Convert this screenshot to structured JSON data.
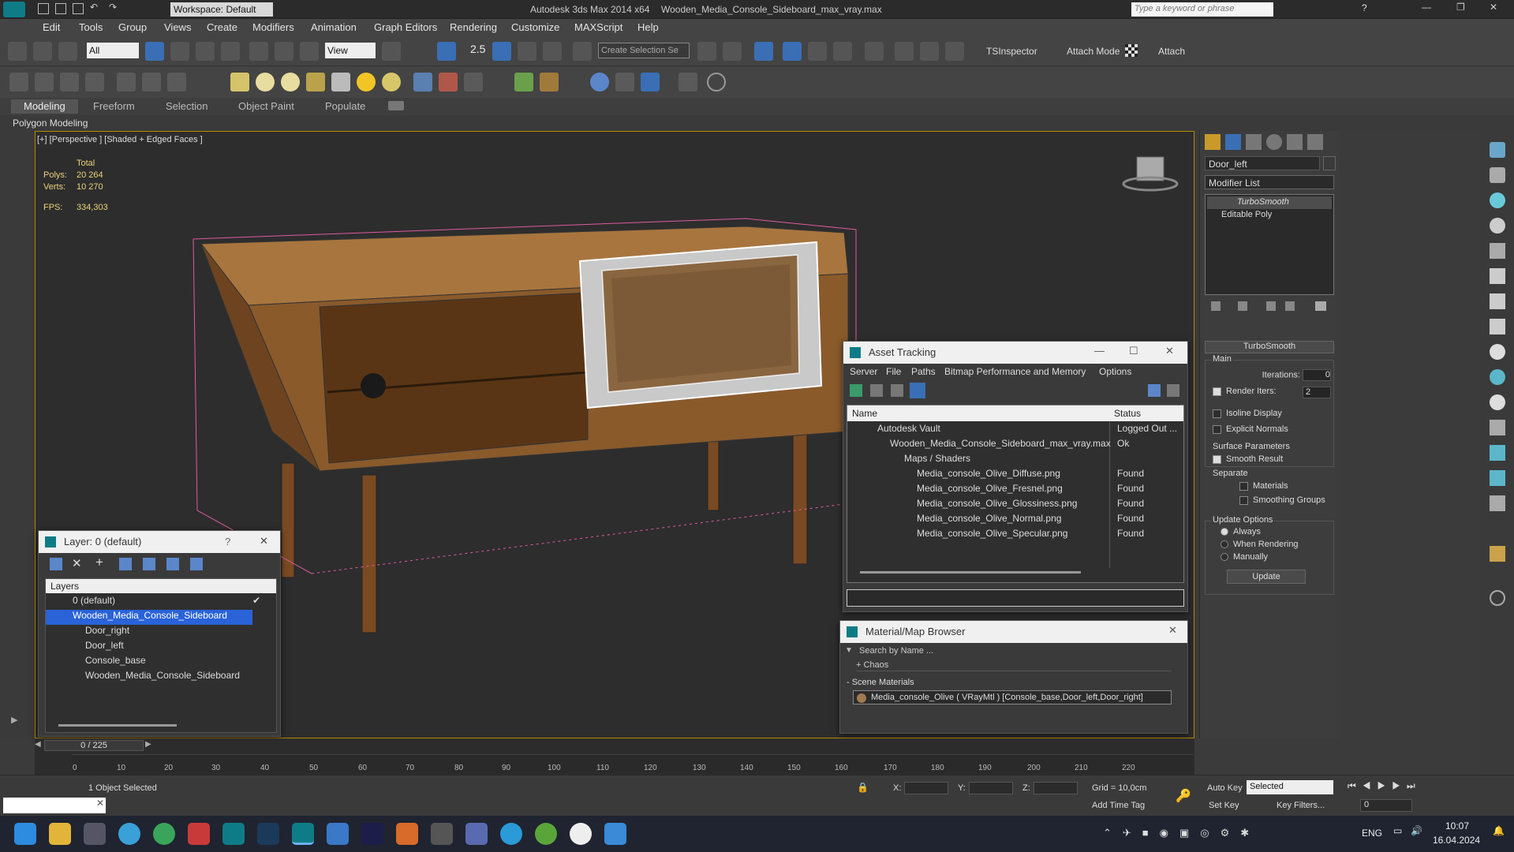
{
  "titlebar": {
    "workspace": "Workspace: Default",
    "app_title": "Autodesk 3ds Max  2014 x64",
    "file_title": "Wooden_Media_Console_Sideboard_max_vray.max",
    "search_placeholder": "Type a keyword or phrase"
  },
  "menu": [
    "Edit",
    "Tools",
    "Group",
    "Views",
    "Create",
    "Modifiers",
    "Animation",
    "Graph Editors",
    "Rendering",
    "Customize",
    "MAXScript",
    "Help"
  ],
  "toolbar": {
    "selection_filter": "All",
    "ref_coord": "View",
    "selection_set_placeholder": "Create Selection Se",
    "tsinspector": "TSInspector",
    "attach_mode": "Attach Mode",
    "attach": "Attach",
    "snap_value": "2.5"
  },
  "ribbon": {
    "tabs": [
      "Modeling",
      "Freeform",
      "Selection",
      "Object Paint",
      "Populate"
    ],
    "subtitle": "Polygon Modeling"
  },
  "viewport": {
    "label": "[+] [Perspective ] [Shaded + Edged Faces ]",
    "stats_header": "Total",
    "polys_label": "Polys:",
    "polys_value": "20 264",
    "verts_label": "Verts:",
    "verts_value": "10 270",
    "fps_label": "FPS:",
    "fps_value": "334,303"
  },
  "layer_window": {
    "title": "Layer: 0 (default)",
    "help": "?",
    "column": "Layers",
    "rows": [
      "0 (default)",
      "Wooden_Media_Console_Sideboard",
      "Door_right",
      "Door_left",
      "Console_base",
      "Wooden_Media_Console_Sideboard"
    ]
  },
  "asset_tracking": {
    "title": "Asset Tracking",
    "menu": [
      "Server",
      "File",
      "Paths",
      "Bitmap Performance and Memory",
      "Options"
    ],
    "col_name": "Name",
    "col_status": "Status",
    "rows": [
      {
        "name": "Autodesk Vault",
        "status": "Logged Out ..."
      },
      {
        "name": "Wooden_Media_Console_Sideboard_max_vray.max",
        "status": "Ok"
      },
      {
        "name": "Maps / Shaders",
        "status": ""
      },
      {
        "name": "Media_console_Olive_Diffuse.png",
        "status": "Found"
      },
      {
        "name": "Media_console_Olive_Fresnel.png",
        "status": "Found"
      },
      {
        "name": "Media_console_Olive_Glossiness.png",
        "status": "Found"
      },
      {
        "name": "Media_console_Olive_Normal.png",
        "status": "Found"
      },
      {
        "name": "Media_console_Olive_Specular.png",
        "status": "Found"
      }
    ]
  },
  "material_browser": {
    "title": "Material/Map Browser",
    "search_placeholder": "Search by Name ...",
    "chaos": "+ Chaos",
    "scene_materials": "- Scene Materials",
    "material": "Media_console_Olive ( VRayMtl ) [Console_base,Door_left,Door_right]"
  },
  "command_panel": {
    "object_name": "Door_left",
    "modifier_list": "Modifier List",
    "stack": [
      "TurboSmooth",
      "Editable Poly"
    ],
    "rollout_title": "TurboSmooth",
    "main_label": "Main",
    "iterations_label": "Iterations:",
    "iterations_value": "0",
    "render_iters_label": "Render Iters:",
    "render_iters_value": "2",
    "isoline": "Isoline Display",
    "explicit_normals": "Explicit Normals",
    "surface_params": "Surface Parameters",
    "smooth_result": "Smooth Result",
    "separate": "Separate",
    "materials": "Materials",
    "smoothing_groups": "Smoothing Groups",
    "update_options": "Update Options",
    "always": "Always",
    "when_rendering": "When Rendering",
    "manually": "Manually",
    "update_btn": "Update"
  },
  "timeline": {
    "frame_counter": "0 / 225",
    "ticks": [
      "0",
      "10",
      "20",
      "30",
      "40",
      "50",
      "60",
      "70",
      "80",
      "90",
      "100",
      "110",
      "120",
      "130",
      "140",
      "150",
      "160",
      "170",
      "180",
      "190",
      "200",
      "210",
      "220"
    ]
  },
  "status": {
    "selected": "1 Object Selected",
    "x_label": "X:",
    "y_label": "Y:",
    "z_label": "Z:",
    "grid": "Grid = 10,0cm",
    "add_time_tag": "Add Time Tag",
    "auto_key": "Auto Key",
    "set_key": "Set Key",
    "key_mode": "Selected",
    "key_filters": "Key Filters...",
    "frame": "0"
  },
  "taskbar": {
    "lang": "ENG",
    "time": "10:07",
    "date": "16.04.2024"
  },
  "colors": {
    "selection_blue": "#2a63d8",
    "viewport_border": "#b88a00",
    "wood": "#8a5a2b"
  }
}
